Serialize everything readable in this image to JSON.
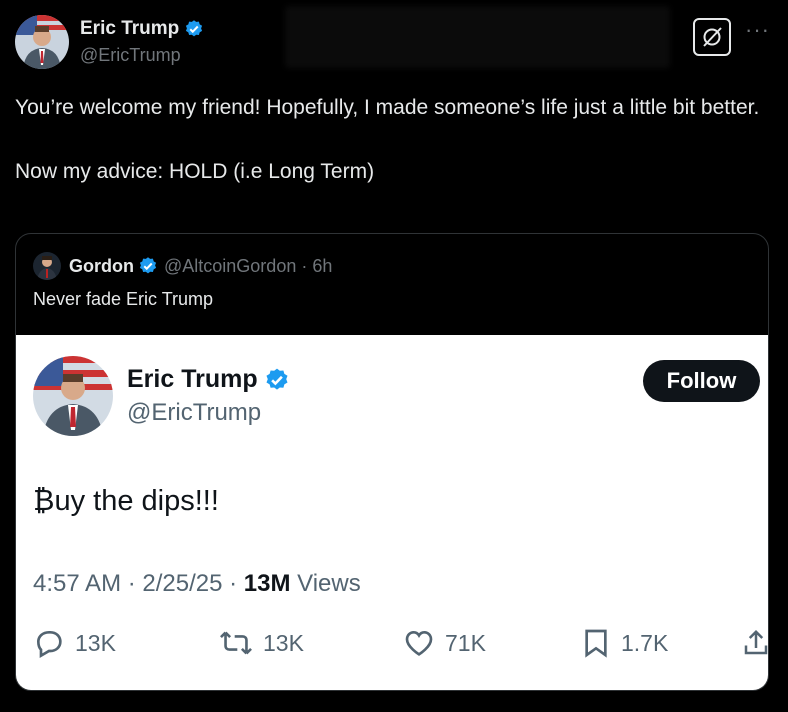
{
  "outer_tweet": {
    "display_name": "Eric Trump",
    "handle": "@EricTrump",
    "verified_icon": "verified-badge-icon",
    "text_lines": [
      "You’re welcome my friend! Hopefully, I made someone’s life just a little bit better.",
      "Now my advice: HOLD (i.e Long Term)"
    ]
  },
  "quote": {
    "display_name": "Gordon",
    "handle": "@AltcoinGordon",
    "time": "· 6h",
    "text": "Never fade Eric Trump"
  },
  "embedded": {
    "display_name": "Eric Trump",
    "handle": "@EricTrump",
    "follow_label": "Follow",
    "text": "₿uy the dips!!!",
    "meta_time": "4:57 AM · 2/25/25 · ",
    "views_count": "13M",
    "views_label": " Views",
    "replies": "13K",
    "reposts": "13K",
    "likes": "71K",
    "bookmarks": "1.7K"
  },
  "colors": {
    "background": "#000000",
    "verified": "#1d9bf0",
    "muted_dark": "#71767b",
    "muted_light": "#536471"
  }
}
